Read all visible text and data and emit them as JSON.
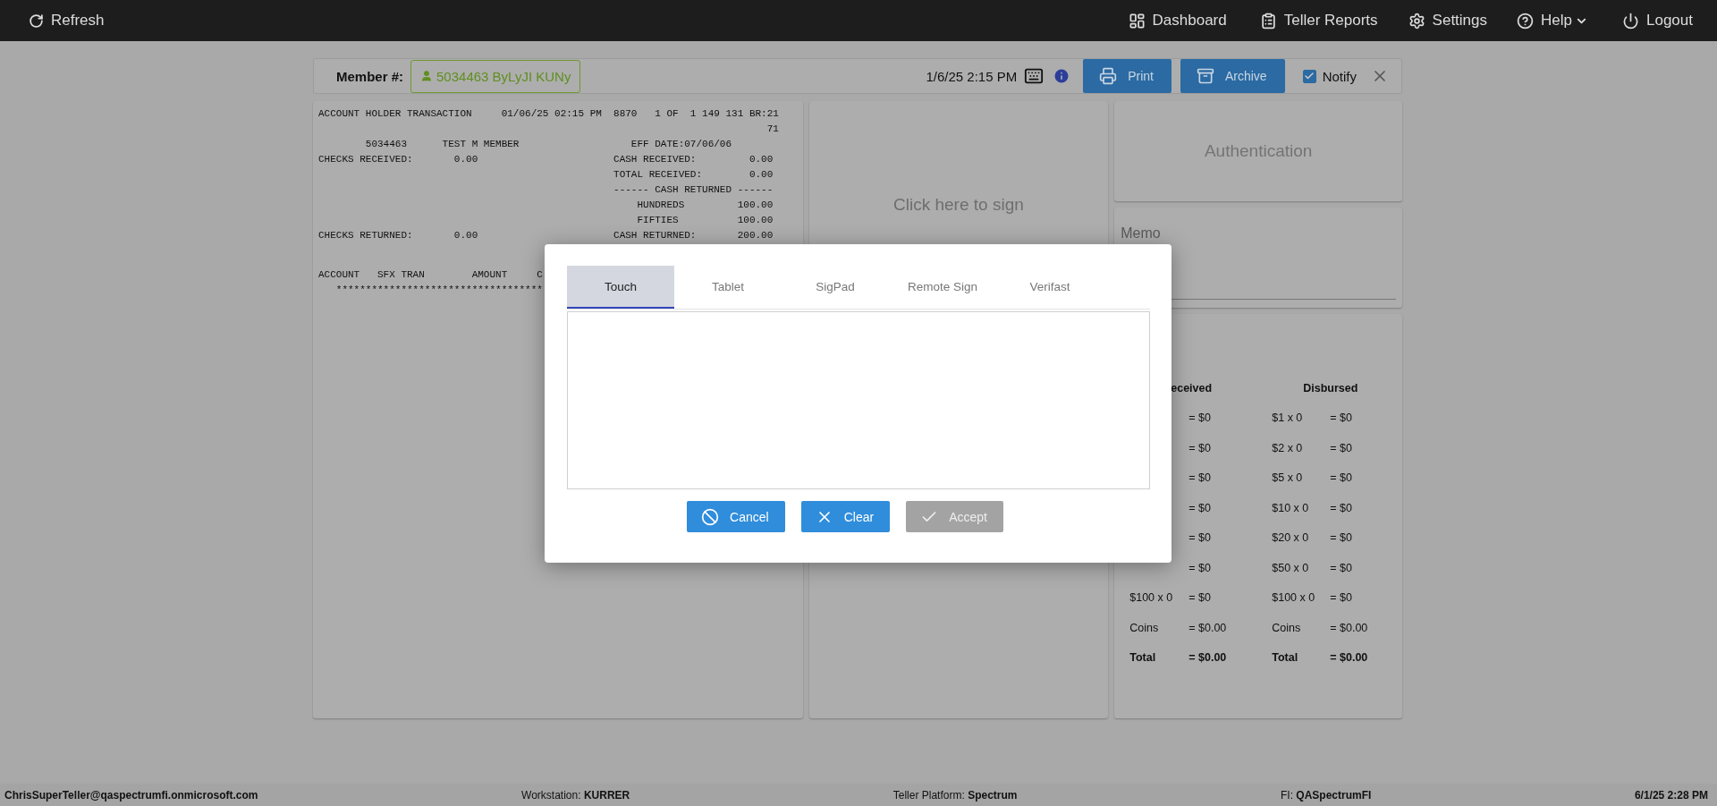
{
  "header": {
    "refresh": "Refresh",
    "nav": [
      {
        "kind": "dashboard",
        "label": "Dashboard",
        "has_menu": false
      },
      {
        "kind": "reports",
        "label": "Teller Reports",
        "has_menu": false
      },
      {
        "kind": "settings",
        "label": "Settings",
        "has_menu": false
      },
      {
        "kind": "help",
        "label": "Help",
        "has_menu": true
      },
      {
        "kind": "logout",
        "label": "Logout",
        "has_menu": false
      }
    ]
  },
  "member_bar": {
    "label": "Member #:",
    "member": "5034463 ByLyJI KUNy",
    "datetime": "1/6/25 2:15 PM",
    "print": "Print",
    "archive": "Archive",
    "notify": {
      "label": "Notify",
      "checked": true
    }
  },
  "receipt": {
    "summary_lines": [
      "ACCOUNT HOLDER TRANSACTION     01/06/25 02:15 PM  8870   1 OF  1 149 131 BR:21",
      "                                                                            71",
      "        5034463      TEST M MEMBER                   EFF DATE:07/06/06",
      "CHECKS RECEIVED:       0.00                       CASH RECEIVED:         0.00",
      "                                                  TOTAL RECEIVED:        0.00",
      "                                                  ------ CASH RETURNED ------",
      "                                                      HUNDREDS         100.00",
      "                                                      FIFTIES          100.00",
      "CHECKS RETURNED:       0.00                       CASH RETURNED:       200.00"
    ],
    "detail_lines": [
      "ACCOUNT   SFX TRAN        AMOUNT     C",
      "   ***********************************"
    ]
  },
  "signature_panel": {
    "prompt": "Click here to sign"
  },
  "authentication": {
    "title": "Authentication"
  },
  "memo": {
    "label": "Memo"
  },
  "cash": {
    "received_heading": "eceived",
    "disbursed_heading": "Disbursed",
    "rows": [
      {
        "kind": "count",
        "received_value": "= $0",
        "disbursed_label": "$1 x 0",
        "disbursed_value": "= $0"
      },
      {
        "kind": "count",
        "received_value": "= $0",
        "disbursed_label": "$2 x 0",
        "disbursed_value": "= $0"
      },
      {
        "kind": "count",
        "received_value": "= $0",
        "disbursed_label": "$5 x 0",
        "disbursed_value": "= $0"
      },
      {
        "kind": "count",
        "received_value": "= $0",
        "disbursed_label": "$10 x 0",
        "disbursed_value": "= $0"
      },
      {
        "kind": "count",
        "received_value": "= $0",
        "disbursed_label": "$20 x 0",
        "disbursed_value": "= $0"
      },
      {
        "kind": "count",
        "received_value": "= $0",
        "disbursed_label": "$50 x 0",
        "disbursed_value": "= $0"
      },
      {
        "kind": "count",
        "received_label": "$100 x 0",
        "received_value": "= $0",
        "disbursed_label": "$100 x 0",
        "disbursed_value": "= $0"
      },
      {
        "kind": "count",
        "received_label": "Coins",
        "received_value": "= $0.00",
        "disbursed_label": "Coins",
        "disbursed_value": "= $0.00"
      },
      {
        "kind": "total",
        "received_label": "Total",
        "received_value": "= $0.00",
        "disbursed_label": "Total",
        "disbursed_value": "= $0.00"
      }
    ]
  },
  "modal": {
    "tabs": [
      {
        "label": "Touch",
        "selected": true
      },
      {
        "label": "Tablet",
        "selected": false
      },
      {
        "label": "SigPad",
        "selected": false
      },
      {
        "label": "Remote Sign",
        "selected": false
      },
      {
        "label": "Verifast",
        "selected": false
      }
    ],
    "buttons": [
      {
        "kind": "cancel",
        "label": "Cancel",
        "disabled": false
      },
      {
        "kind": "clear",
        "label": "Clear",
        "disabled": false
      },
      {
        "kind": "accept",
        "label": "Accept",
        "disabled": true
      }
    ]
  },
  "status_bar": [
    {
      "text": "**ChrisSuperTeller@qaspectrumfi.onmicrosoft.com**"
    },
    {
      "text": "Workstation: **KURRER**"
    },
    {
      "text": "Teller Platform: **Spectrum**"
    },
    {
      "text": "FI: **QASpectrumFI**"
    },
    {
      "text": "**6/1/25 2:28 PM**"
    }
  ]
}
